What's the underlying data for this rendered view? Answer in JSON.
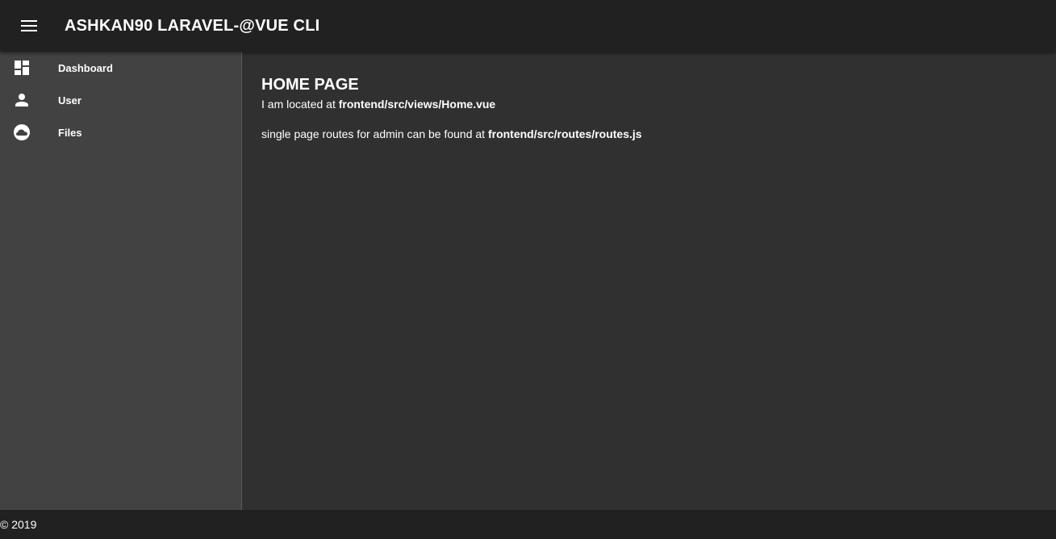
{
  "app_bar": {
    "menu_icon": "hamburger-menu-icon",
    "title": "ASHKAN90 LARAVEL-@VUE CLI",
    "background": "#212121"
  },
  "sidebar": {
    "background": "#424242",
    "items": [
      {
        "label": "Dashboard",
        "icon": "dashboard-icon"
      },
      {
        "label": "User",
        "icon": "person-icon"
      },
      {
        "label": "Files",
        "icon": "cloud-icon"
      }
    ]
  },
  "main": {
    "background": "#303030",
    "title": "HOME PAGE",
    "location_prefix": "I am located at ",
    "location_path": "frontend/src/views/Home.vue",
    "routes_prefix": "single page routes for admin can be found at ",
    "routes_path": "frontend/src/routes/routes.js"
  },
  "footer": {
    "text": "© 2019"
  }
}
